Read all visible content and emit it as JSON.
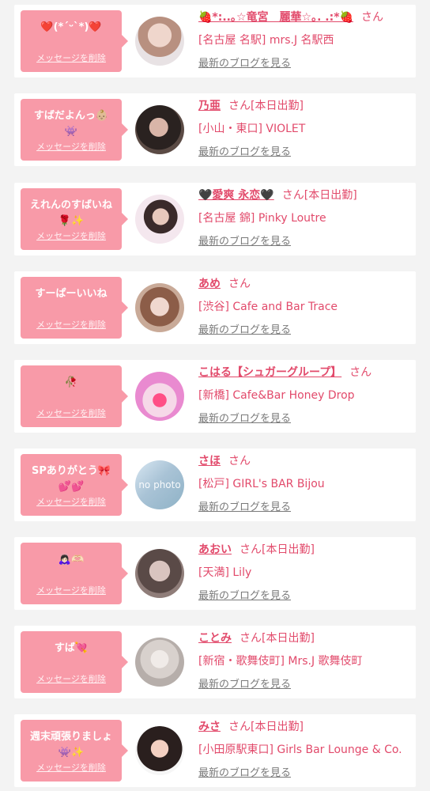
{
  "colors": {
    "page_background": "#f3f3f3",
    "card_background": "#ffffff",
    "bubble_pink": "#f89aa8",
    "accent_text": "#e24a6b",
    "muted_link": "#7a7a7a"
  },
  "messages": [
    {
      "bubble_text": "❤️(*´ᵕ`*)❤️",
      "delete_label": "メッセージを削除",
      "avatar_alt": "",
      "name": "🍓*:..｡☆竜宮　麗華☆｡. .:*🍓",
      "suffix": "さん",
      "shop": "[名古屋 名駅] mrs.J 名駅西",
      "blog_link": "最新のブログを見る"
    },
    {
      "bubble_text": "すばだよんっ👶🏼\n👾",
      "delete_label": "メッセージを削除",
      "avatar_alt": "",
      "name": "乃亜",
      "suffix": "さん[本日出勤]",
      "shop": "[小山・東口] VIOLET",
      "blog_link": "最新のブログを見る"
    },
    {
      "bubble_text": "えれんのすばいね\n🌹✨",
      "delete_label": "メッセージを削除",
      "avatar_alt": "",
      "name": "🖤愛爽 永恋🖤",
      "suffix": "さん[本日出勤]",
      "shop": "[名古屋 錦] Pinky Loutre",
      "blog_link": "最新のブログを見る"
    },
    {
      "bubble_text": "すーぱーいいね",
      "delete_label": "メッセージを削除",
      "avatar_alt": "",
      "name": "あめ",
      "suffix": "さん",
      "shop": "[渋谷] Cafe and Bar Trace",
      "blog_link": "最新のブログを見る"
    },
    {
      "bubble_text": "🥀",
      "delete_label": "メッセージを削除",
      "avatar_alt": "",
      "name": "こはる【シュガーグループ】",
      "suffix": "さん",
      "shop": "[新橋] Cafe&Bar Honey Drop",
      "blog_link": "最新のブログを見る"
    },
    {
      "bubble_text": "SPありがとう🎀\n💕💕",
      "delete_label": "メッセージを削除",
      "avatar_alt": "no photo",
      "name": "さほ",
      "suffix": "さん",
      "shop": "[松戸] GIRL's BAR Bijou",
      "blog_link": "最新のブログを見る"
    },
    {
      "bubble_text": "🙇🏻‍♀️🫶🏻",
      "delete_label": "メッセージを削除",
      "avatar_alt": "",
      "name": "あおい",
      "suffix": "さん[本日出勤]",
      "shop": "[天満] Lily",
      "blog_link": "最新のブログを見る"
    },
    {
      "bubble_text": "すば💘",
      "delete_label": "メッセージを削除",
      "avatar_alt": "",
      "name": "ことみ",
      "suffix": "さん[本日出勤]",
      "shop": "[新宿・歌舞伎町] Mrs.J 歌舞伎町",
      "blog_link": "最新のブログを見る"
    },
    {
      "bubble_text": "週末頑張りましょ\n👾✨",
      "delete_label": "メッセージを削除",
      "avatar_alt": "",
      "name": "みさ",
      "suffix": "さん[本日出勤]",
      "shop": "[小田原駅東口] Girls Bar Lounge & Co.",
      "blog_link": "最新のブログを見る"
    }
  ]
}
